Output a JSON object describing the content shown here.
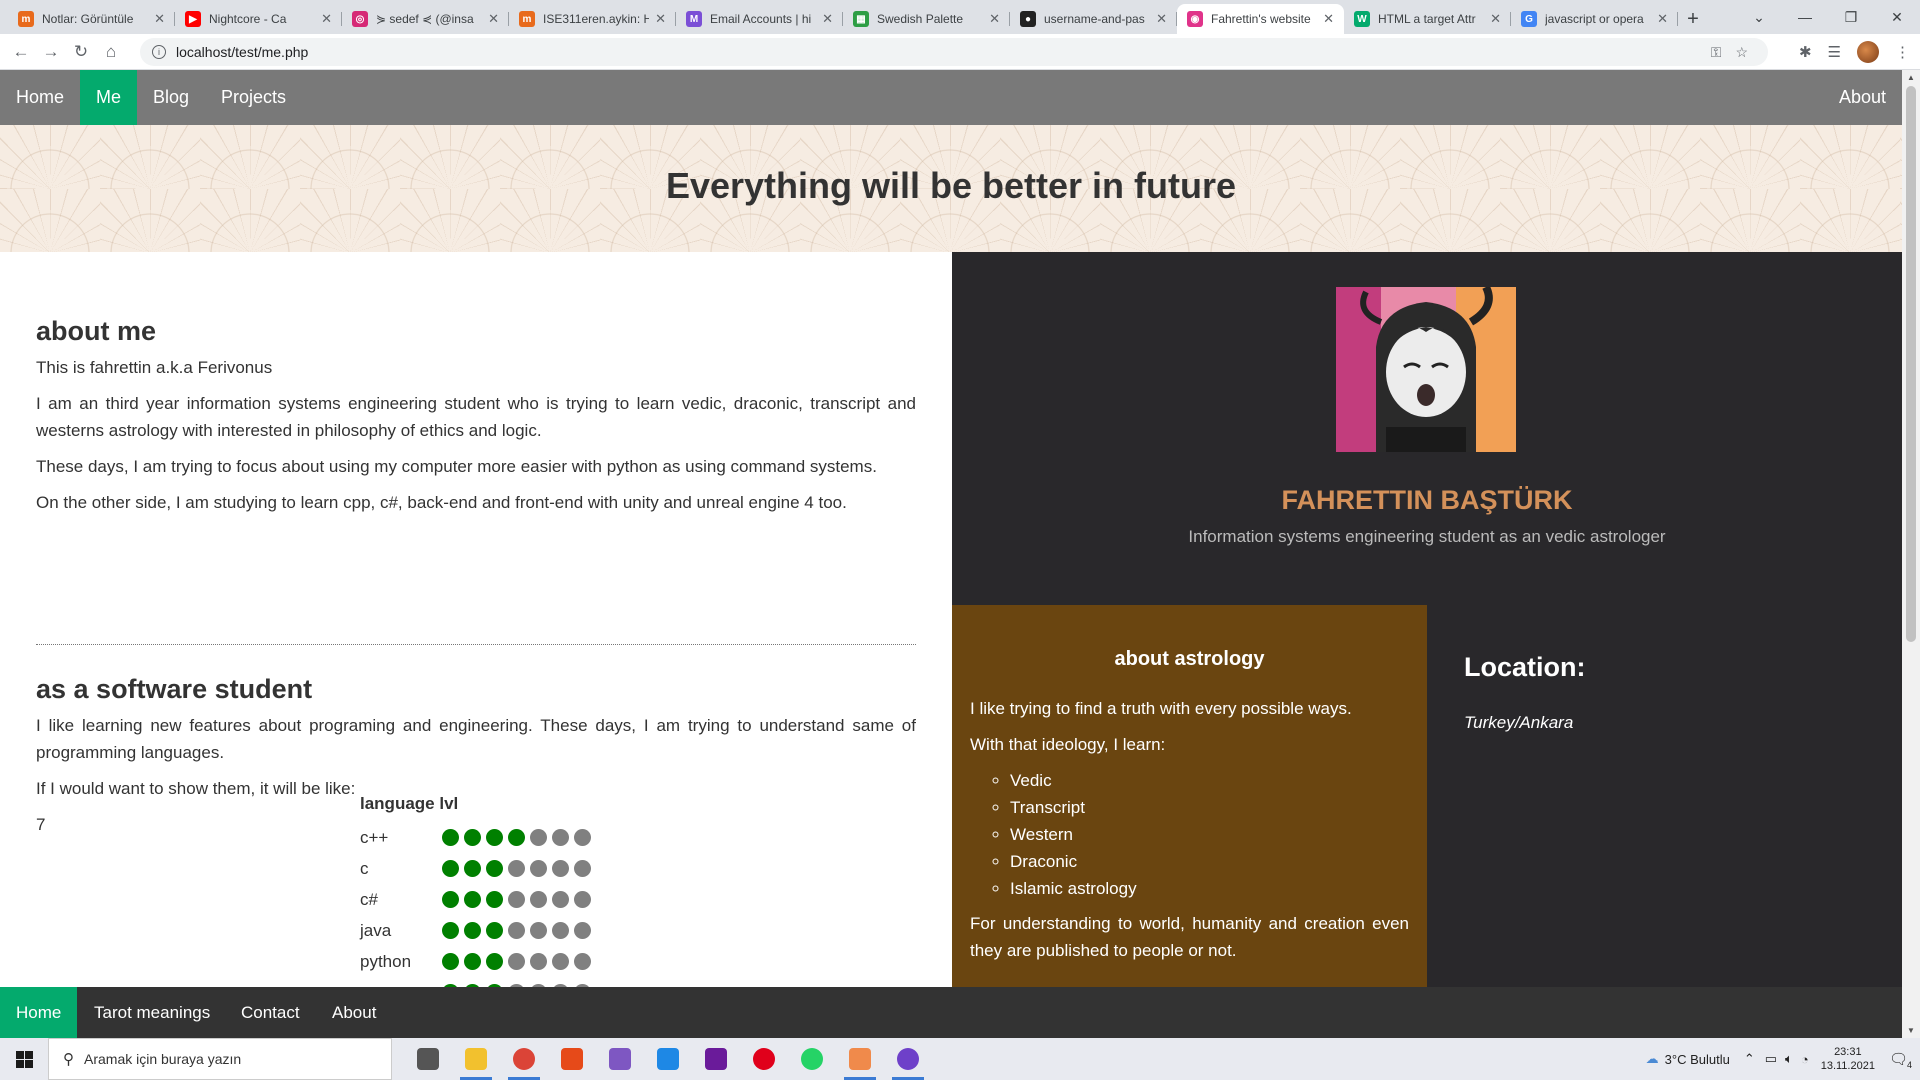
{
  "browser": {
    "tabs": [
      {
        "title": "Notlar: Görüntüle",
        "fav_color": "#e86a1c",
        "fav_glyph": "m"
      },
      {
        "title": "Nightcore - Ca",
        "fav_color": "#ff0000",
        "fav_glyph": "▶"
      },
      {
        "title": "⋟ sedef ⋞ (@insa",
        "fav_color": "#d62976",
        "fav_glyph": "◎"
      },
      {
        "title": "ISE311eren.aykin: H",
        "fav_color": "#e86a1c",
        "fav_glyph": "m"
      },
      {
        "title": "Email Accounts | hi",
        "fav_color": "#7b4fd6",
        "fav_glyph": "M"
      },
      {
        "title": "Swedish Palette",
        "fav_color": "#2e9e45",
        "fav_glyph": "▦"
      },
      {
        "title": "username-and-pas",
        "fav_color": "#222222",
        "fav_glyph": "●"
      },
      {
        "title": "Fahrettin's website",
        "fav_color": "#e0338a",
        "fav_glyph": "◉"
      },
      {
        "title": "HTML a target Attr",
        "fav_color": "#04aa6d",
        "fav_glyph": "W"
      },
      {
        "title": "javascript or opera",
        "fav_color": "#4285f4",
        "fav_glyph": "G"
      }
    ],
    "active_tab_index": 7,
    "url": "localhost/test/me.php"
  },
  "top_nav": {
    "items": [
      "Home",
      "Me",
      "Blog",
      "Projects"
    ],
    "active": "Me",
    "right_item": "About"
  },
  "hero": {
    "title": "Everything will be better in future"
  },
  "about_me": {
    "heading": "about me",
    "paragraphs": [
      "This is fahrettin a.k.a Ferivonus",
      "I am an third year information systems engineering student who is trying to learn vedic, draconic, transcript and westerns astrology with interested in philosophy of ethics and logic.",
      "These days, I am trying to focus about using my computer more easier with python as using command systems.",
      "On the other side, I am studying to learn cpp, c#, back-end and front-end with unity and unreal engine 4 too."
    ]
  },
  "software": {
    "heading": "as a software student",
    "paragraphs": [
      "I like learning new features about programing and engineering. These days, I am trying to understand same of programming languages.",
      "If I would want to show them, it will be like:"
    ],
    "number": "7",
    "table_heading": "language lvl",
    "max_level": 7,
    "languages": [
      {
        "name": "c++",
        "level": 4
      },
      {
        "name": "c",
        "level": 3
      },
      {
        "name": "c#",
        "level": 3
      },
      {
        "name": "java",
        "level": 3
      },
      {
        "name": "python",
        "level": 3
      },
      {
        "name": "",
        "level": 3
      }
    ]
  },
  "profile": {
    "name": "FAHRETTIN BAŞTÜRK",
    "subtitle": "Information systems engineering student as an vedic astrologer"
  },
  "astrology": {
    "heading": "about astrology",
    "intro": "I like trying to find a truth with every possible ways.",
    "lead": "With that ideology, I learn:",
    "items": [
      "Vedic",
      "Transcript",
      "Western",
      "Draconic",
      "Islamic astrology"
    ],
    "outro": "For understanding to world, humanity and creation even they are published to people or not."
  },
  "location": {
    "heading": "Location:",
    "city": "Turkey/Ankara"
  },
  "bottom_nav": {
    "items": [
      "Home",
      "Tarot meanings",
      "Contact",
      "About"
    ],
    "active": "Home"
  },
  "taskbar": {
    "search_placeholder": "Aramak için buraya yazın",
    "apps": [
      {
        "name": "task-view",
        "color": "#555555"
      },
      {
        "name": "file-explorer",
        "color": "#f2c12e"
      },
      {
        "name": "chrome",
        "color": "#db4437"
      },
      {
        "name": "office",
        "color": "#e64a19"
      },
      {
        "name": "visual-studio",
        "color": "#7e57c2"
      },
      {
        "name": "vscode",
        "color": "#1e88e5"
      },
      {
        "name": "winrar",
        "color": "#6a1b9a"
      },
      {
        "name": "opera",
        "color": "#e0001b"
      },
      {
        "name": "whatsapp",
        "color": "#25d366"
      },
      {
        "name": "discord-ptb",
        "color": "#f08a4b"
      },
      {
        "name": "github-desktop",
        "color": "#6e40c9"
      }
    ],
    "weather": "3°C  Bulutlu",
    "time": "23:31",
    "date": "13.11.2021",
    "notifications": "4"
  }
}
